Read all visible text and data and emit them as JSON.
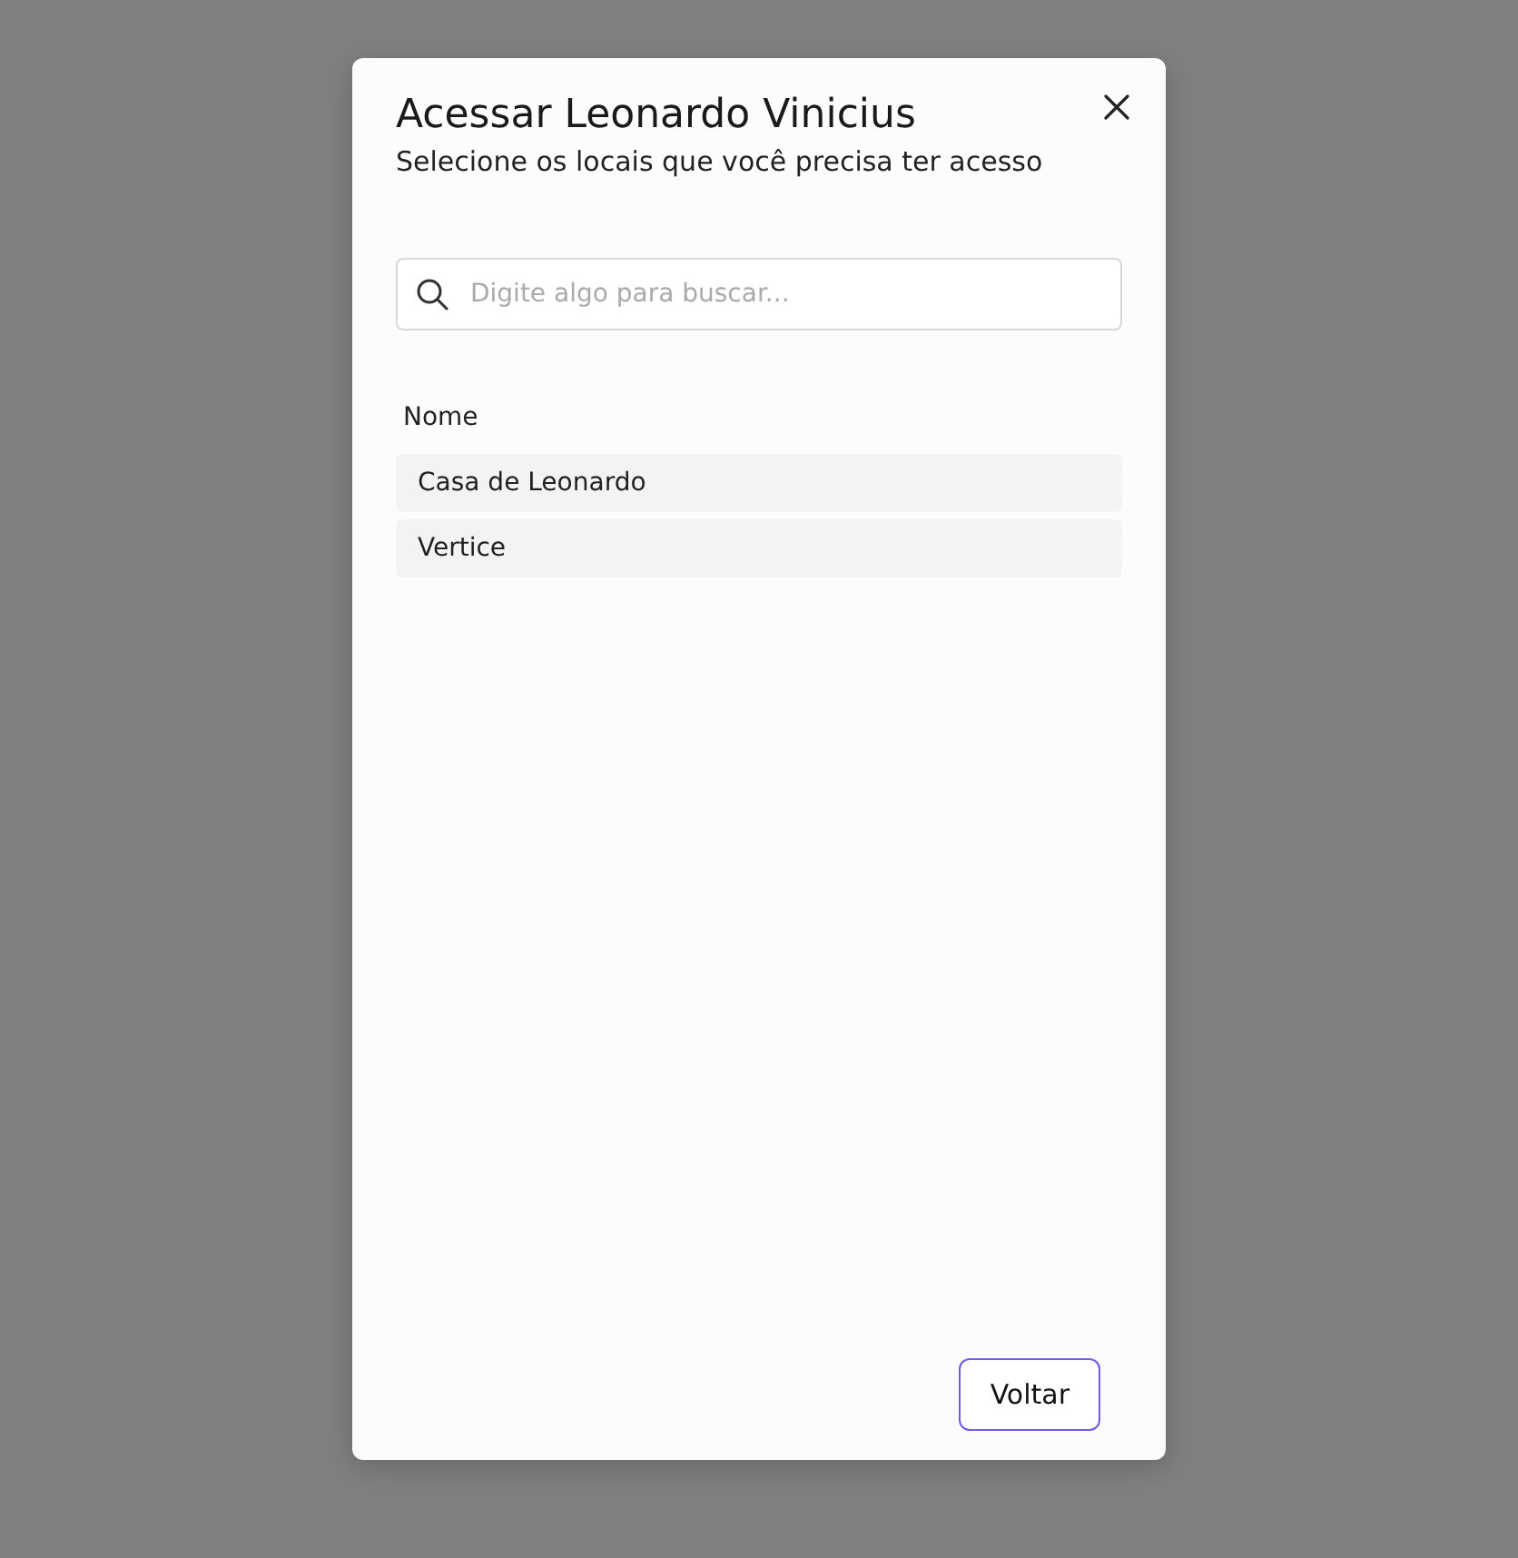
{
  "dialog": {
    "title": "Acessar Leonardo Vinicius",
    "subtitle": "Selecione os locais que você precisa ter acesso"
  },
  "search": {
    "placeholder": "Digite algo para buscar..."
  },
  "table": {
    "columns": [
      "Nome"
    ],
    "rows": [
      {
        "name": "Casa de Leonardo"
      },
      {
        "name": "Vertice"
      }
    ]
  },
  "buttons": [
    "Voltar"
  ]
}
